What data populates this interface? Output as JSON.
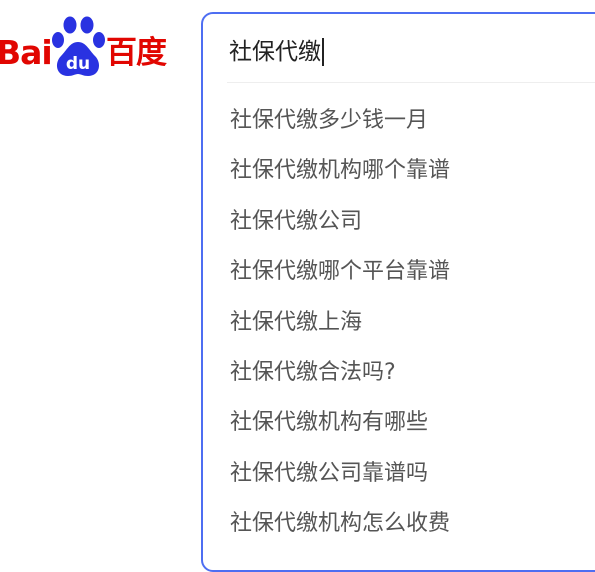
{
  "logo": {
    "text_left": "Bai",
    "paw_text": "du",
    "text_right": "百度",
    "color": "#e10601"
  },
  "search": {
    "value": "社保代缴",
    "border_color": "#4e6ef2"
  },
  "suggestions": [
    "社保代缴多少钱一月",
    "社保代缴机构哪个靠谱",
    "社保代缴公司",
    "社保代缴哪个平台靠谱",
    "社保代缴上海",
    "社保代缴合法吗?",
    "社保代缴机构有哪些",
    "社保代缴公司靠谱吗",
    "社保代缴机构怎么收费"
  ]
}
